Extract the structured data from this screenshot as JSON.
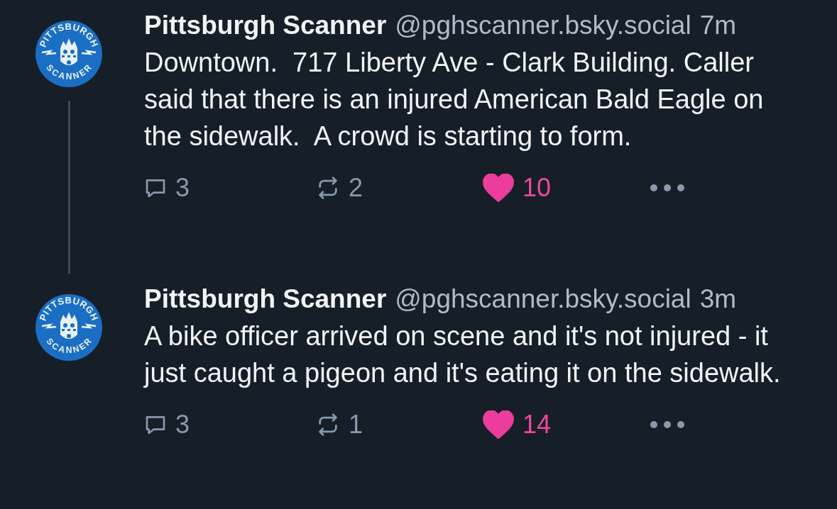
{
  "posts": [
    {
      "avatar": {
        "top_text": "PITTSBURGH",
        "bottom_text": "SCANNER"
      },
      "display_name": "Pittsburgh Scanner",
      "handle": "@pghscanner.bsky.social",
      "time": "7m",
      "text": "Downtown.  717 Liberty Ave - Clark Building. Caller said that there is an injured American Bald Eagle on the sidewalk.  A crowd is starting to form.",
      "replies": "3",
      "reposts": "2",
      "likes": "10",
      "liked": true,
      "thread_continues": true
    },
    {
      "avatar": {
        "top_text": "PITTSBURGH",
        "bottom_text": "SCANNER"
      },
      "display_name": "Pittsburgh Scanner",
      "handle": "@pghscanner.bsky.social",
      "time": "3m",
      "text": "A bike officer arrived on scene and it's not injured - it just caught a pigeon and it's eating it on the sidewalk.",
      "replies": "3",
      "reposts": "1",
      "likes": "14",
      "liked": true,
      "thread_continues": false
    }
  ]
}
